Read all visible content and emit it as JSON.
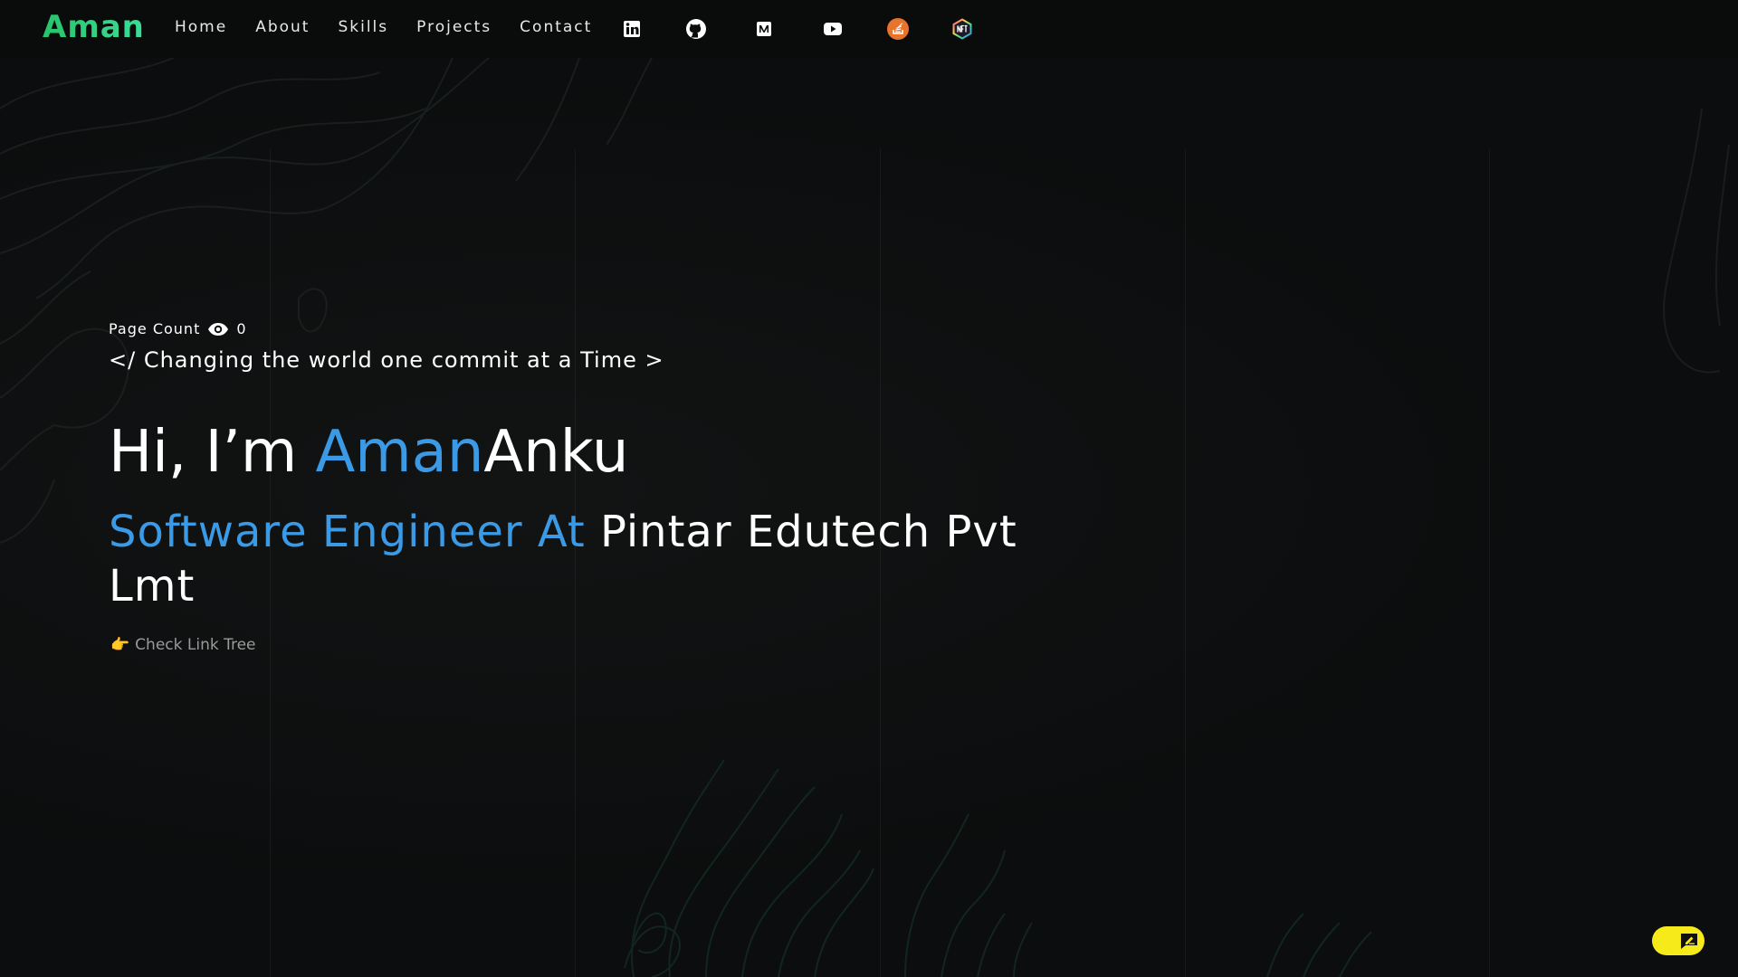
{
  "brand": {
    "logo_text": "Aman",
    "logo_color": "#2ecc71"
  },
  "nav": {
    "links": [
      {
        "label": "Home"
      },
      {
        "label": "About"
      },
      {
        "label": "Skills"
      },
      {
        "label": "Projects"
      },
      {
        "label": "Contact"
      }
    ],
    "social": [
      {
        "icon": "linkedin-icon"
      },
      {
        "icon": "github-icon"
      },
      {
        "icon": "medium-icon"
      },
      {
        "icon": "youtube-icon"
      },
      {
        "icon": "stackoverflow-icon"
      },
      {
        "icon": "nft-icon"
      }
    ]
  },
  "hero": {
    "page_count_label": "Page Count",
    "page_count_value": "0",
    "tagline": "</ Changing the world one commit at a Time >",
    "greeting": "Hi, I’m ",
    "first_name": "Aman",
    "last_name": "Anku",
    "role": "Software Engineer At ",
    "company": "Pintar Edutech Pvt Lmt",
    "link_tree_emoji": "👉",
    "link_tree_label": "Check Link Tree"
  },
  "colors": {
    "accent": "#3b9ae6",
    "background": "#0b0d0e",
    "chat_button": "#f6ea1a"
  }
}
